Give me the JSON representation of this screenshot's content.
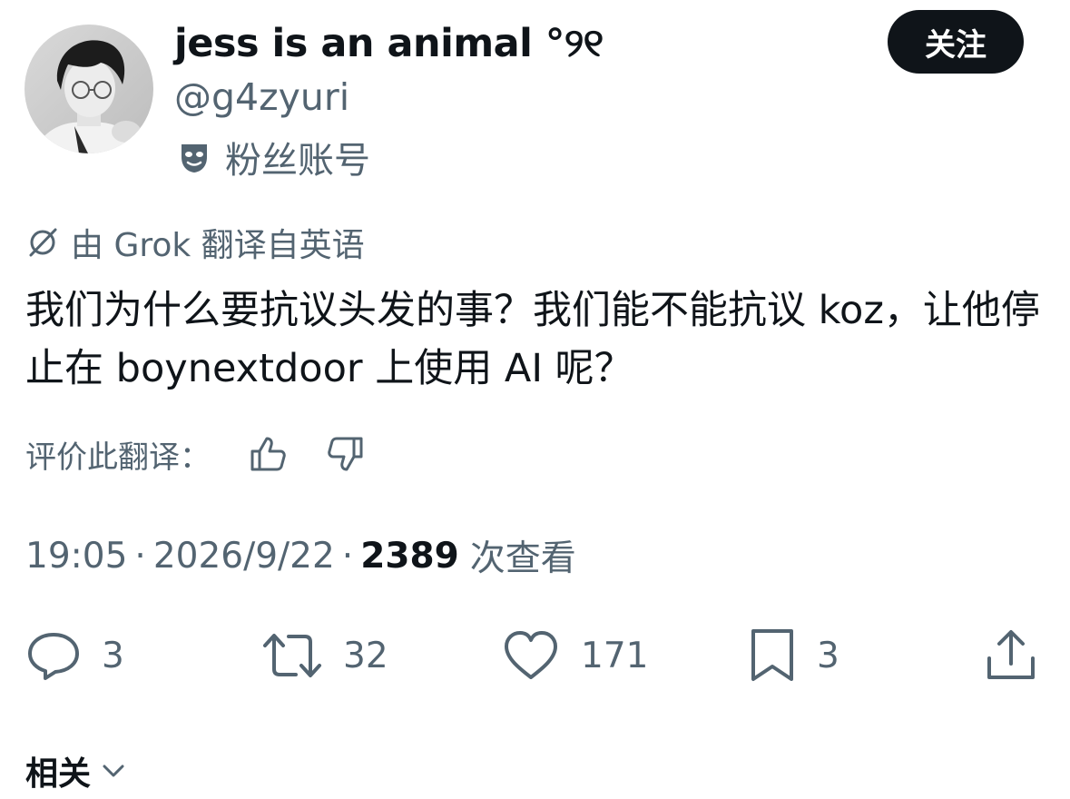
{
  "profile": {
    "display_name": "jess is an animal °୨୧",
    "handle": "@g4zyuri",
    "account_label": "粉丝账号",
    "follow_label": "关注"
  },
  "translation": {
    "note": "由 Grok 翻译自英语",
    "text": "我们为什么要抗议头发的事？我们能不能抗议 koz，让他停止在 boynextdoor 上使用 AI 呢？",
    "rate_label": "评价此翻译："
  },
  "meta": {
    "time": "19:05",
    "date": "2026/9/22",
    "separator": "·",
    "views_count": "2389",
    "views_label": "次查看"
  },
  "actions": {
    "replies": "3",
    "reposts": "32",
    "likes": "171",
    "bookmarks": "3"
  },
  "related": {
    "label": "相关"
  },
  "icons": {
    "translation": "grok-icon",
    "account_badge": "mask-icon",
    "rate_up": "thumbs-up-icon",
    "rate_down": "thumbs-down-icon",
    "reply": "reply-icon",
    "repost": "repost-icon",
    "like": "heart-icon",
    "bookmark": "bookmark-icon",
    "share": "share-icon",
    "related": "chevron-down-icon"
  },
  "colors": {
    "primary_text": "#0f1419",
    "secondary_text": "#536471",
    "button_bg": "#0f1419",
    "button_text": "#ffffff"
  }
}
